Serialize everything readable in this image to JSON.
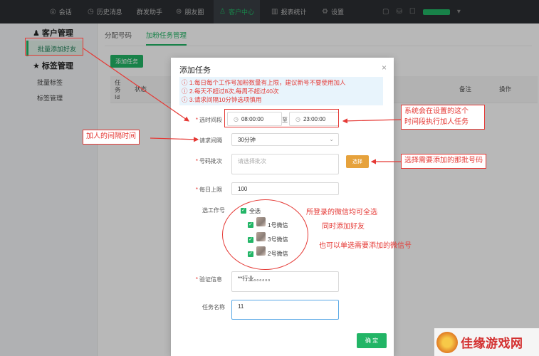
{
  "topnav": [
    {
      "icon": "chat-icon",
      "label": "会话"
    },
    {
      "icon": "clock-icon",
      "label": "历史消息"
    },
    {
      "icon": "",
      "label": "群发助手"
    },
    {
      "icon": "moments-icon",
      "label": "朋友圈"
    },
    {
      "icon": "user-icon",
      "label": "客户中心"
    },
    {
      "icon": "chart-icon",
      "label": "报表统计"
    },
    {
      "icon": "gear-icon",
      "label": "设置"
    }
  ],
  "sidebar": {
    "group1": "客户管理",
    "group1_item": "批量添加好友",
    "group2": "标签管理",
    "group2_items": [
      "批量标签",
      "标签管理"
    ]
  },
  "main": {
    "tabs": [
      "分配号码",
      "加粉任务管理"
    ],
    "add_task": "添加任务",
    "headers": [
      "任务Id",
      "状态",
      "备注",
      "操作"
    ]
  },
  "modal": {
    "title": "添加任务",
    "close": "×",
    "notices": [
      "1.每日每个工作号加粉数量有上限，建议新号不要使用加人",
      "2.每天不超过8次,每周不超过40次",
      "3.请求间隔10分钟选项慎用"
    ],
    "time_label": "选时间段",
    "time_start": "08:00:00",
    "time_sep": "至",
    "time_end": "23:00:00",
    "interval_label": "请求间隔",
    "interval_value": "30分钟",
    "batch_label": "号码批次",
    "batch_placeholder": "请选择批次",
    "batch_button": "选择",
    "limit_label": "每日上限",
    "limit_value": "100",
    "worker_label": "选工作号",
    "select_all": "全选",
    "workers": [
      "1号微信",
      "3号微信",
      "2号微信"
    ],
    "verify_label": "验证信息",
    "verify_value": "**行业。。。。。。",
    "task_name_label": "任务名称",
    "task_name_value": "11",
    "confirm": "确 定"
  },
  "annotations": {
    "time_note": "系统会在设置的这个\n时间段执行加人任务",
    "interval_note": "加人的间隔时间",
    "batch_note": "选择需要添加的那批号码",
    "worker_note1": "所登录的微信均可全选",
    "worker_note2": "同时添加好友",
    "worker_note3": "也可以单选需要添加的微信号"
  },
  "watermark": "佳缘游戏网"
}
